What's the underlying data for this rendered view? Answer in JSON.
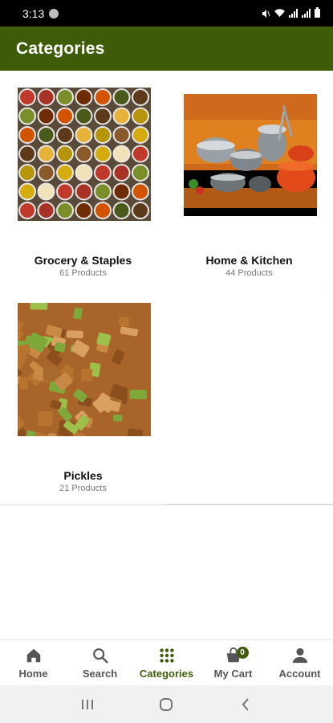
{
  "status_bar": {
    "time": "3:13"
  },
  "app_bar": {
    "title": "Categories"
  },
  "categories": [
    {
      "name": "Grocery & Staples",
      "count": "61 Products"
    },
    {
      "name": "Home & Kitchen",
      "count": "44 Products"
    },
    {
      "name": "Pickles",
      "count": "21 Products"
    }
  ],
  "bottom_nav": {
    "items": [
      {
        "label": "Home",
        "icon": "home-icon"
      },
      {
        "label": "Search",
        "icon": "search-icon"
      },
      {
        "label": "Categories",
        "icon": "grid-icon",
        "active": true
      },
      {
        "label": "My Cart",
        "icon": "cart-icon",
        "badge": "0"
      },
      {
        "label": "Account",
        "icon": "person-icon"
      }
    ]
  },
  "colors": {
    "brand": "#3e5c08",
    "status_bar": "#000000",
    "muted_text": "#7a7a7a"
  }
}
